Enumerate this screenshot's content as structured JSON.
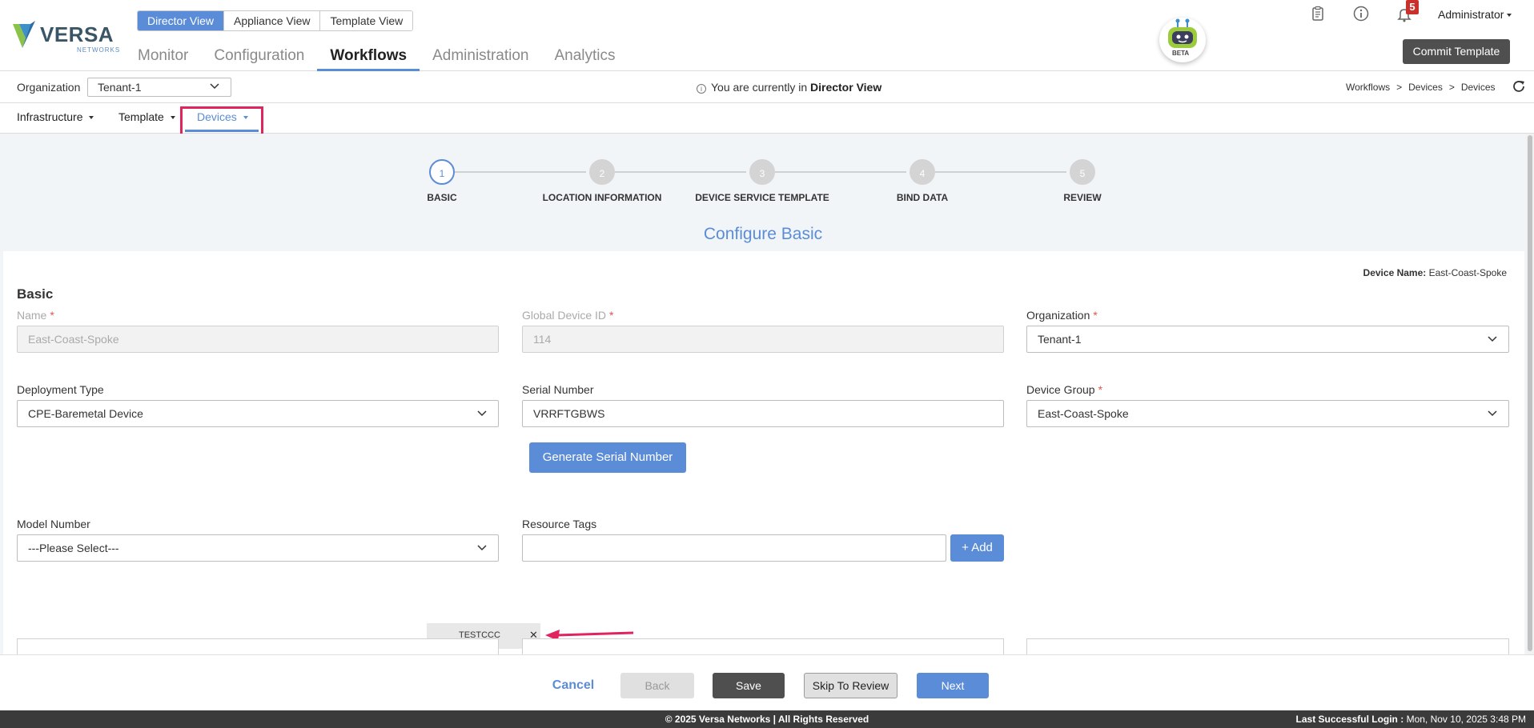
{
  "header": {
    "logo_text": "VERSA",
    "logo_sub": "NETWORKS",
    "view_toggle": [
      {
        "label": "Director View",
        "active": true
      },
      {
        "label": "Appliance View",
        "active": false
      },
      {
        "label": "Template View",
        "active": false
      }
    ],
    "main_nav": [
      {
        "label": "Monitor",
        "active": false
      },
      {
        "label": "Configuration",
        "active": false
      },
      {
        "label": "Workflows",
        "active": true
      },
      {
        "label": "Administration",
        "active": false
      },
      {
        "label": "Analytics",
        "active": false
      }
    ],
    "bot_badge": "BETA",
    "notification_count": "5",
    "user_menu": "Administrator",
    "commit_button": "Commit Template",
    "icons": [
      "clipboard-icon",
      "info-icon",
      "bell-icon"
    ]
  },
  "org_bar": {
    "label": "Organization",
    "selected_org": "Tenant-1",
    "view_message_prefix": "You are currently in",
    "view_message_bold": "Director View",
    "breadcrumb": [
      "Workflows",
      "Devices",
      "Devices"
    ],
    "breadcrumb_sep": ">"
  },
  "sub_nav": [
    {
      "label": "Infrastructure",
      "active": false
    },
    {
      "label": "Template",
      "active": false
    },
    {
      "label": "Devices",
      "active": true
    }
  ],
  "stepper": {
    "steps": [
      {
        "num": "1",
        "label": "BASIC",
        "active": true
      },
      {
        "num": "2",
        "label": "LOCATION INFORMATION",
        "active": false
      },
      {
        "num": "3",
        "label": "DEVICE SERVICE TEMPLATE",
        "active": false
      },
      {
        "num": "4",
        "label": "BIND DATA",
        "active": false
      },
      {
        "num": "5",
        "label": "REVIEW",
        "active": false
      }
    ],
    "title": "Configure Basic"
  },
  "form": {
    "device_name_label": "Device Name:",
    "device_name_value": "East-Coast-Spoke",
    "section_title": "Basic",
    "required_mark": "*",
    "name": {
      "label": "Name",
      "value": "East-Coast-Spoke"
    },
    "global_device_id": {
      "label": "Global Device ID",
      "value": "114"
    },
    "organization": {
      "label": "Organization",
      "value": "Tenant-1"
    },
    "deployment_type": {
      "label": "Deployment Type",
      "value": "CPE-Baremetal Device"
    },
    "serial_number": {
      "label": "Serial Number",
      "value": "VRRFTGBWS"
    },
    "device_group": {
      "label": "Device Group",
      "value": "East-Coast-Spoke"
    },
    "generate_serial_button": "Generate Serial Number",
    "model_number": {
      "label": "Model Number",
      "value": "---Please Select---"
    },
    "resource_tags": {
      "label": "Resource Tags",
      "value": "",
      "add_button": "+ Add",
      "tags": [
        "TESTCCC"
      ]
    }
  },
  "actions": {
    "cancel": "Cancel",
    "back": "Back",
    "save": "Save",
    "skip": "Skip To Review",
    "next": "Next"
  },
  "footer": {
    "copyright": "© 2025 Versa Networks | All Rights Reserved",
    "last_login_label": "Last Successful Login :",
    "last_login_value": "Mon, Nov 10, 2025 3:48 PM"
  },
  "colors": {
    "accent": "#5b8cd8",
    "highlight": "#e0245e",
    "badge": "#c9302c",
    "dark_button": "#4f4f4f"
  }
}
